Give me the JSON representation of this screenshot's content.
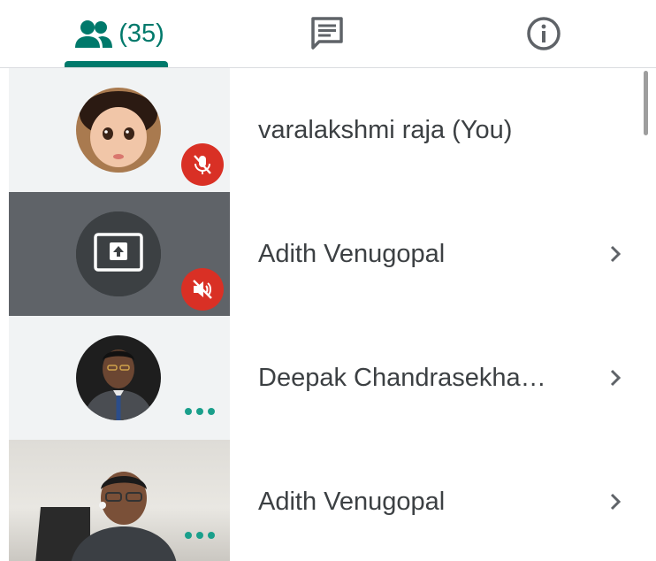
{
  "tabs": {
    "people": {
      "icon": "people-icon",
      "count_label": "(35)"
    },
    "chat": {
      "icon": "chat-icon"
    },
    "info": {
      "icon": "info-icon"
    },
    "active": "people",
    "accent_color": "#00796b"
  },
  "participants": [
    {
      "name": "varalakshmi raja (You)",
      "status_icon": "mic-off-icon",
      "has_chevron": false
    },
    {
      "name": "Adith Venugopal",
      "status_icon": "volume-off-icon",
      "thumbnail_icon": "present-screen-icon",
      "has_chevron": true
    },
    {
      "name": "Deepak Chandrasekha…",
      "status_icon": "more-dots-icon",
      "has_chevron": true
    },
    {
      "name": "Adith Venugopal",
      "status_icon": "more-dots-icon",
      "has_chevron": true
    }
  ],
  "colors": {
    "mute_badge": "#d93025",
    "dots": "#1a9f8b",
    "text": "#3c4043"
  }
}
